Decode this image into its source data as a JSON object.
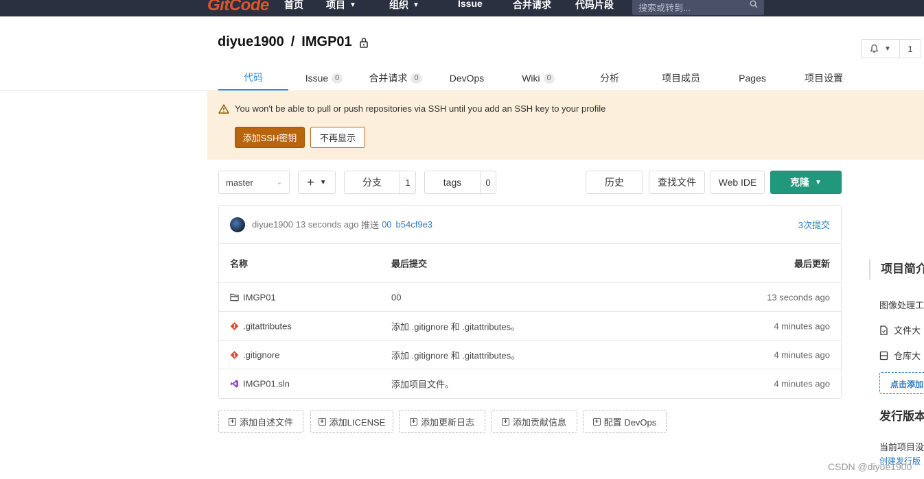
{
  "navbar": {
    "logo": "GitCode",
    "items": [
      {
        "label": "首页",
        "dropdown": false
      },
      {
        "label": "项目",
        "dropdown": true
      },
      {
        "label": "组织",
        "dropdown": true
      },
      {
        "label": "Issue",
        "dropdown": false
      },
      {
        "label": "合并请求",
        "dropdown": false
      },
      {
        "label": "代码片段",
        "dropdown": false
      }
    ],
    "search_placeholder": "搜索或转到..."
  },
  "repo": {
    "owner": "diyue1900",
    "separator": "/",
    "name": "IMGP01",
    "private_icon": "lock-icon",
    "notifications_count": "1"
  },
  "tabs": [
    {
      "label": "代码",
      "active": true,
      "badge": null
    },
    {
      "label": "Issue",
      "active": false,
      "badge": "0"
    },
    {
      "label": "合并请求",
      "active": false,
      "badge": "0"
    },
    {
      "label": "DevOps",
      "active": false,
      "badge": null
    },
    {
      "label": "Wiki",
      "active": false,
      "badge": "0"
    },
    {
      "label": "分析",
      "active": false,
      "badge": null
    },
    {
      "label": "项目成员",
      "active": false,
      "badge": null
    },
    {
      "label": "Pages",
      "active": false,
      "badge": null
    },
    {
      "label": "项目设置",
      "active": false,
      "badge": null
    }
  ],
  "warning": {
    "message": "You won't be able to pull or push repositories via SSH until you add an SSH key to your profile",
    "add_button": "添加SSH密钥",
    "dismiss_button": "不再显示"
  },
  "toolbar": {
    "branch": "master",
    "branches_label": "分支",
    "branches_count": "1",
    "tags_label": "tags",
    "tags_count": "0",
    "history": "历史",
    "find_file": "查找文件",
    "web_ide": "Web IDE",
    "clone": "克隆"
  },
  "last_commit": {
    "author": "diyue1900",
    "time": "13 seconds ago",
    "action": "推送",
    "message": "00",
    "sha": "b54cf9e3",
    "commits_link": "3次提交"
  },
  "file_table": {
    "headers": {
      "name": "名称",
      "last_commit": "最后提交",
      "last_update": "最后更新"
    },
    "rows": [
      {
        "icon": "folder-icon",
        "name": "IMGP01",
        "commit": "00",
        "updated": "13 seconds ago"
      },
      {
        "icon": "git-icon",
        "name": ".gitattributes",
        "commit": "添加 .gitignore 和 .gitattributes。",
        "updated": "4 minutes ago"
      },
      {
        "icon": "git-icon",
        "name": ".gitignore",
        "commit": "添加 .gitignore 和 .gitattributes。",
        "updated": "4 minutes ago"
      },
      {
        "icon": "visual-studio-icon",
        "name": "IMGP01.sln",
        "commit": "添加项目文件。",
        "updated": "4 minutes ago"
      }
    ]
  },
  "actions": [
    "添加自述文件",
    "添加LICENSE",
    "添加更新日志",
    "添加贡献信息",
    "配置 DevOps"
  ],
  "sidebar": {
    "title": "项目简介",
    "description": "图像处理工",
    "file_size": "文件大",
    "repo_size": "仓库大",
    "add_button": "点击添加",
    "release_title": "发行版本",
    "release_text": "当前项目没",
    "create_release": "创建发行版"
  },
  "watermark": "CSDN @diyue1900",
  "colors": {
    "navbar_bg": "#2b3040",
    "logo": "#e0542e",
    "tab_active": "#2e8ad6",
    "warning_bg": "#fcefdc",
    "warning_button": "#b8650e",
    "clone_button": "#21977c",
    "link": "#2e7abc"
  }
}
